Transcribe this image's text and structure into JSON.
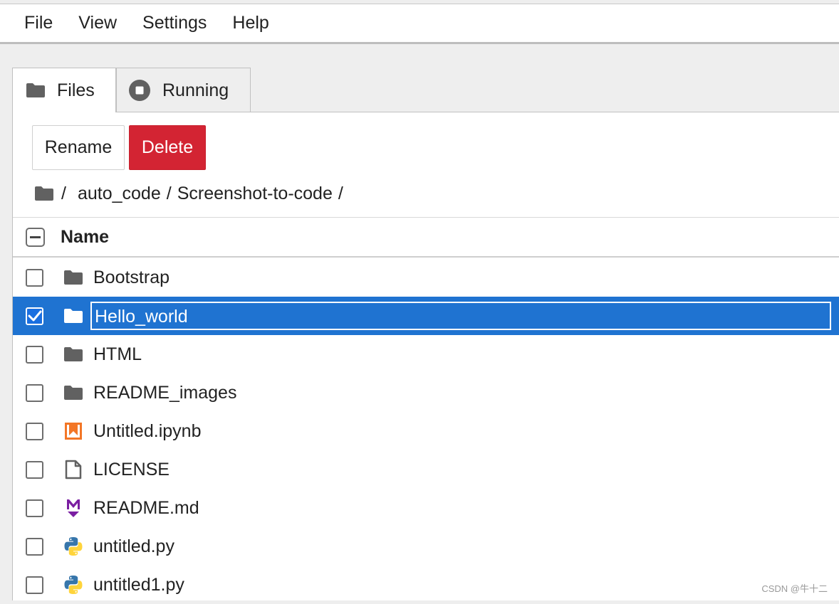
{
  "menubar": {
    "items": [
      "File",
      "View",
      "Settings",
      "Help"
    ]
  },
  "tabs": [
    {
      "label": "Files",
      "icon": "folder-icon",
      "active": true
    },
    {
      "label": "Running",
      "icon": "stop-circle-icon",
      "active": false
    }
  ],
  "toolbar": {
    "rename_label": "Rename",
    "delete_label": "Delete",
    "delete_color": "#d32433"
  },
  "breadcrumb": {
    "icon": "folder-icon",
    "parts": [
      "/",
      "auto_code",
      "/",
      "Screenshot-to-code",
      "/"
    ]
  },
  "list": {
    "header_label": "Name",
    "selection_color": "#1f73d1",
    "items": [
      {
        "name": "Bootstrap",
        "type": "folder",
        "icon": "folder-icon",
        "checked": false
      },
      {
        "name": "Hello_world",
        "type": "folder",
        "icon": "folder-icon",
        "checked": true
      },
      {
        "name": "HTML",
        "type": "folder",
        "icon": "folder-icon",
        "checked": false
      },
      {
        "name": "README_images",
        "type": "folder",
        "icon": "folder-icon",
        "checked": false
      },
      {
        "name": "Untitled.ipynb",
        "type": "notebook",
        "icon": "notebook-icon",
        "checked": false
      },
      {
        "name": "LICENSE",
        "type": "file",
        "icon": "file-icon",
        "checked": false
      },
      {
        "name": "README.md",
        "type": "markdown",
        "icon": "markdown-icon",
        "checked": false
      },
      {
        "name": "untitled.py",
        "type": "python",
        "icon": "python-icon",
        "checked": false
      },
      {
        "name": "untitled1.py",
        "type": "python",
        "icon": "python-icon",
        "checked": false
      }
    ]
  },
  "watermark": "CSDN @牛十二"
}
